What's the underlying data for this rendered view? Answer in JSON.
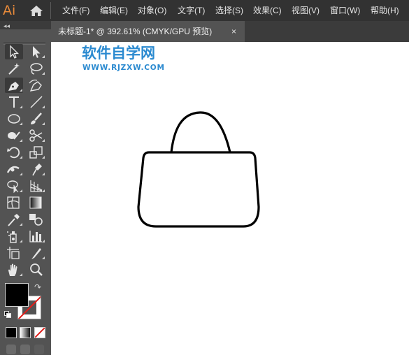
{
  "app": {
    "logo_text": "Ai"
  },
  "menu": {
    "items": [
      {
        "label": "文件(F)"
      },
      {
        "label": "编辑(E)"
      },
      {
        "label": "对象(O)"
      },
      {
        "label": "文字(T)"
      },
      {
        "label": "选择(S)"
      },
      {
        "label": "效果(C)"
      },
      {
        "label": "视图(V)"
      },
      {
        "label": "窗口(W)"
      },
      {
        "label": "帮助(H)"
      }
    ]
  },
  "panel": {
    "collapse_glyph": "◂◂"
  },
  "document": {
    "tab_title": "未标题-1* @ 392.61% (CMYK/GPU 预览)",
    "close_glyph": "×"
  },
  "tools": [
    {
      "icon": "selection-icon"
    },
    {
      "icon": "direct-selection-icon"
    },
    {
      "icon": "magic-wand-icon"
    },
    {
      "icon": "lasso-icon"
    },
    {
      "icon": "pen-icon"
    },
    {
      "icon": "curvature-icon"
    },
    {
      "icon": "type-icon"
    },
    {
      "icon": "line-segment-icon"
    },
    {
      "icon": "ellipse-icon"
    },
    {
      "icon": "paintbrush-icon"
    },
    {
      "icon": "shaper-icon"
    },
    {
      "icon": "scissors-icon"
    },
    {
      "icon": "rotate-icon"
    },
    {
      "icon": "scale-icon"
    },
    {
      "icon": "width-icon"
    },
    {
      "icon": "puppet-warp-icon"
    },
    {
      "icon": "shape-builder-icon"
    },
    {
      "icon": "perspective-grid-icon"
    },
    {
      "icon": "mesh-icon"
    },
    {
      "icon": "gradient-icon"
    },
    {
      "icon": "eyedropper-icon"
    },
    {
      "icon": "blend-icon"
    },
    {
      "icon": "symbol-sprayer-icon"
    },
    {
      "icon": "column-graph-icon"
    },
    {
      "icon": "artboard-icon"
    },
    {
      "icon": "slice-icon"
    },
    {
      "icon": "hand-icon"
    },
    {
      "icon": "zoom-icon"
    }
  ],
  "colors": {
    "fill": "#000000",
    "stroke": "none",
    "watermark": "#2b8ad0",
    "ui_dark": "#323232",
    "ui_panel": "#535353",
    "accent_logo": "#e88a3a"
  },
  "watermark": {
    "title": "软件自学网",
    "url": "WWW.RJZXW.COM"
  }
}
